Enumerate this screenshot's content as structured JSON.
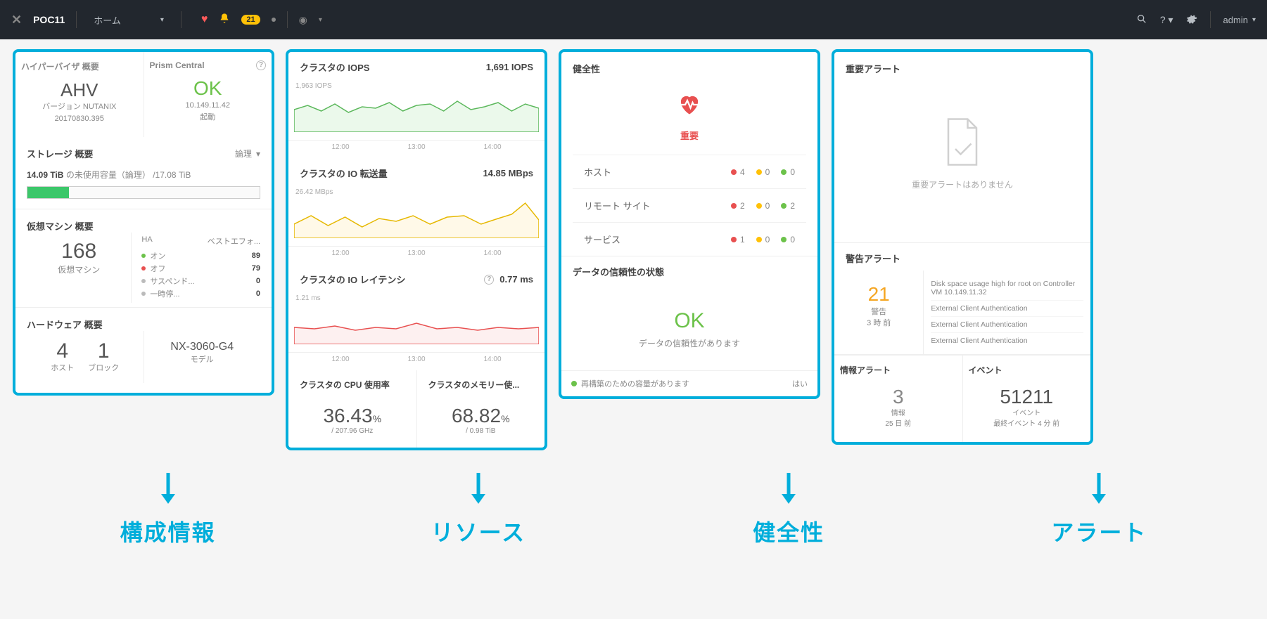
{
  "header": {
    "cluster": "POC11",
    "home": "ホーム",
    "badge": "21",
    "admin": "admin"
  },
  "hypervisor": {
    "title": "ハイパーバイザ 概要",
    "prism": "Prism Central",
    "name": "AHV",
    "version": "バージョン NUTANIX",
    "build": "20170830.395",
    "ok": "OK",
    "ip": "10.149.11.42",
    "status": "起動"
  },
  "storage": {
    "title": "ストレージ 概要",
    "mode": "論理",
    "free": "14.09 TiB",
    "free_lbl": "の未使用容量（論理）",
    "total": "/17.08 TiB"
  },
  "vm": {
    "title": "仮想マシン 概要",
    "count": "168",
    "lbl": "仮想マシン",
    "ha": "HA",
    "effort": "ベストエフォ...",
    "stats": [
      {
        "lbl": "オン",
        "color": "green",
        "cnt": "89"
      },
      {
        "lbl": "オフ",
        "color": "red",
        "cnt": "79"
      },
      {
        "lbl": "サスペンド...",
        "color": "grey",
        "cnt": "0"
      },
      {
        "lbl": "一時停...",
        "color": "grey",
        "cnt": "0"
      }
    ]
  },
  "hw": {
    "title": "ハードウェア 概要",
    "hosts": "4",
    "hosts_lbl": "ホスト",
    "blocks": "1",
    "blocks_lbl": "ブロック",
    "model": "NX-3060-G4",
    "model_lbl": "モデル"
  },
  "iops": {
    "title": "クラスタの IOPS",
    "val": "1,691 IOPS",
    "peak": "1,963 IOPS"
  },
  "bw": {
    "title": "クラスタの IO 転送量",
    "val": "14.85 MBps",
    "peak": "26.42 MBps"
  },
  "lat": {
    "title": "クラスタの IO レイテンシ",
    "val": "0.77 ms",
    "peak": "1.21 ms"
  },
  "times": [
    "12:00",
    "13:00",
    "14:00"
  ],
  "cpu": {
    "title": "クラスタの CPU 使用率",
    "val": "36.43",
    "pct": "%",
    "detail": "/ 207.96 GHz"
  },
  "mem": {
    "title": "クラスタのメモリー使...",
    "val": "68.82",
    "pct": "%",
    "detail": "/ 0.98 TiB"
  },
  "health": {
    "title": "健全性",
    "critical": "重要",
    "rows": [
      {
        "name": "ホスト",
        "r": "4",
        "y": "0",
        "g": "0"
      },
      {
        "name": "リモート サイト",
        "r": "2",
        "y": "0",
        "g": "2"
      },
      {
        "name": "サービス",
        "r": "1",
        "y": "0",
        "g": "0"
      }
    ]
  },
  "integrity": {
    "title": "データの信頼性の状態",
    "ok": "OK",
    "msg": "データの信頼性があります",
    "footer": "再構築のための容量があります",
    "yes": "はい"
  },
  "alert": {
    "title": "重要アラート",
    "none": "重要アラートはありません"
  },
  "warn": {
    "title": "警告アラート",
    "num": "21",
    "lbl": "警告",
    "time": "3 時 前",
    "items": [
      "Disk space usage high for root on Controller VM 10.149.11.32",
      "External Client Authentication",
      "External Client Authentication",
      "External Client Authentication"
    ]
  },
  "info": {
    "title": "情報アラート",
    "num": "3",
    "lbl": "情報",
    "time": "25 日 前"
  },
  "events": {
    "title": "イベント",
    "num": "51211",
    "lbl": "イベント",
    "time": "最終イベント 4 分 前"
  },
  "sections": [
    "構成情報",
    "リソース",
    "健全性",
    "アラート"
  ],
  "chart_data": [
    {
      "type": "line",
      "title": "クラスタの IOPS",
      "ylabel": "IOPS",
      "ylim": [
        0,
        1963
      ],
      "x": [
        "12:00",
        "13:00",
        "14:00"
      ],
      "values": [
        1691
      ],
      "peak": 1963,
      "color": "#7cd97c"
    },
    {
      "type": "line",
      "title": "クラスタの IO 転送量",
      "ylabel": "MBps",
      "ylim": [
        0,
        26.42
      ],
      "x": [
        "12:00",
        "13:00",
        "14:00"
      ],
      "values": [
        14.85
      ],
      "peak": 26.42,
      "color": "#f5c85a"
    },
    {
      "type": "line",
      "title": "クラスタの IO レイテンシ",
      "ylabel": "ms",
      "ylim": [
        0,
        1.21
      ],
      "x": [
        "12:00",
        "13:00",
        "14:00"
      ],
      "values": [
        0.77
      ],
      "peak": 1.21,
      "color": "#f08a8a"
    }
  ]
}
